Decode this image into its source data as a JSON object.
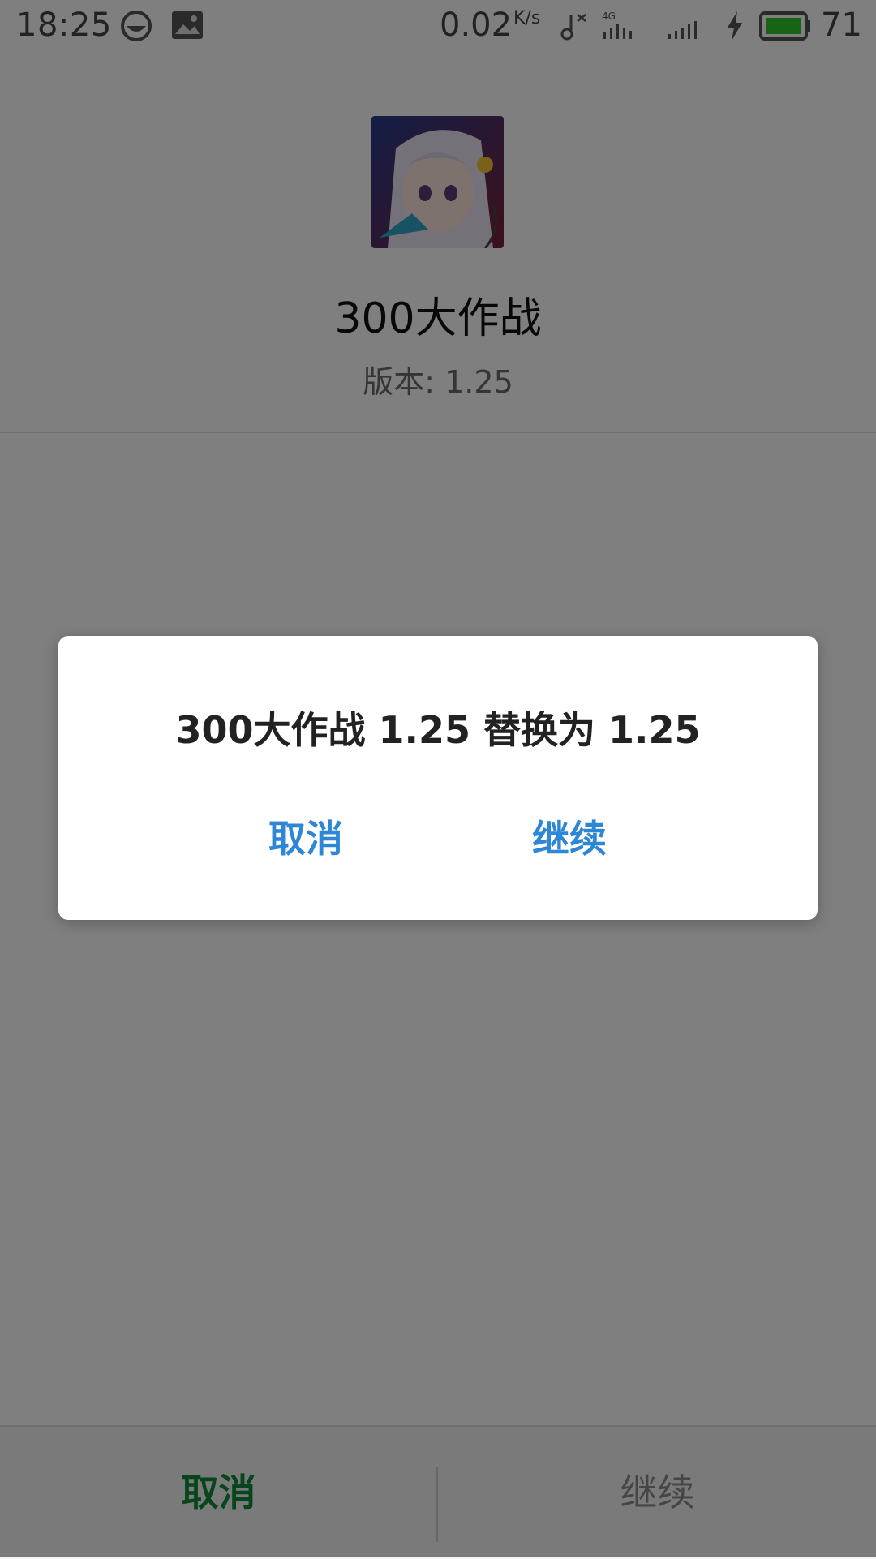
{
  "status_bar": {
    "time": "18:25",
    "net_speed": "0.02",
    "net_speed_unit": "K/s",
    "battery_level": "71",
    "battery_color": "#2fc82f",
    "icons": [
      "face-icon",
      "image-icon",
      "music-off-icon",
      "signal-4g-icon",
      "signal-icon",
      "charging-icon",
      "battery-icon"
    ]
  },
  "app": {
    "name": "300大作战",
    "version_label": "版本: 1.25"
  },
  "dialog": {
    "message": "300大作战 1.25 替换为 1.25",
    "cancel_label": "取消",
    "continue_label": "继续",
    "button_color": "#2e86d6"
  },
  "bottom_bar": {
    "cancel_label": "取消",
    "continue_label": "继续",
    "cancel_color": "#118a38"
  }
}
